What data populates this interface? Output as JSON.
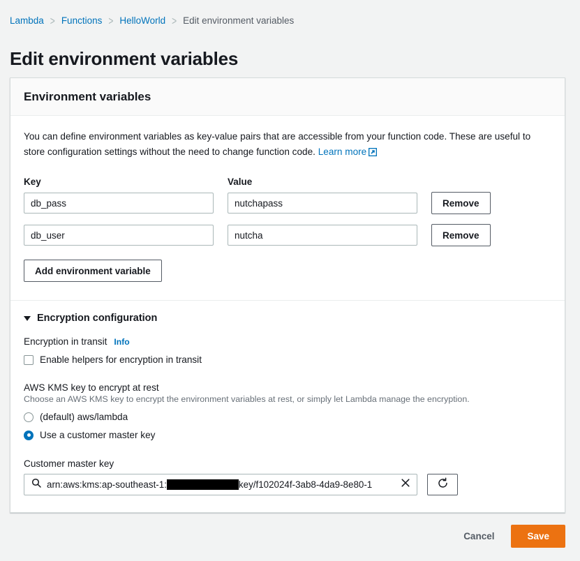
{
  "breadcrumb": {
    "items": [
      {
        "label": "Lambda",
        "current": false
      },
      {
        "label": "Functions",
        "current": false
      },
      {
        "label": "HelloWorld",
        "current": false
      },
      {
        "label": "Edit environment variables",
        "current": true
      }
    ],
    "separator": ">"
  },
  "page": {
    "title": "Edit environment variables"
  },
  "card": {
    "header_title": "Environment variables",
    "description_part1": "You can define environment variables as key-value pairs that are accessible from your function code. These are useful to store configuration settings without the need to change function code.",
    "learn_more_label": "Learn more",
    "learn_more_icon": "external-link-icon"
  },
  "variables": {
    "key_column_header": "Key",
    "value_column_header": "Value",
    "rows": [
      {
        "key": "db_pass",
        "value": "nutchapass",
        "remove_label": "Remove"
      },
      {
        "key": "db_user",
        "value": "nutcha",
        "remove_label": "Remove"
      }
    ],
    "add_label": "Add environment variable"
  },
  "encryption": {
    "section_title": "Encryption configuration",
    "section_expanded": true,
    "caret_icon": "caret-down-icon",
    "in_transit_label": "Encryption in transit",
    "info_label": "Info",
    "enable_helpers_label": "Enable helpers for encryption in transit",
    "enable_helpers_checked": false,
    "kms_label": "AWS KMS key to encrypt at rest",
    "kms_hint": "Choose an AWS KMS key to encrypt the environment variables at rest, or simply let Lambda manage the encryption.",
    "kms_options": [
      {
        "label": "(default) aws/lambda",
        "selected": false
      },
      {
        "label": "Use a customer master key",
        "selected": true
      }
    ],
    "cmk_label": "Customer master key",
    "cmk_search_icon": "search-icon",
    "cmk_clear_icon": "close-icon",
    "cmk_refresh_icon": "refresh-icon",
    "cmk_value_prefix": "arn:aws:kms:ap-southeast-1:",
    "cmk_value_redacted": "[REDACTED]",
    "cmk_value_suffix": "key/f102024f-3ab8-4da9-8e80-1"
  },
  "footer": {
    "cancel_label": "Cancel",
    "save_label": "Save"
  },
  "colors": {
    "link": "#0073bb",
    "save_button": "#ec7211",
    "page_background": "#f2f3f3",
    "border": "#aab7b8",
    "muted_text": "#545b64"
  }
}
